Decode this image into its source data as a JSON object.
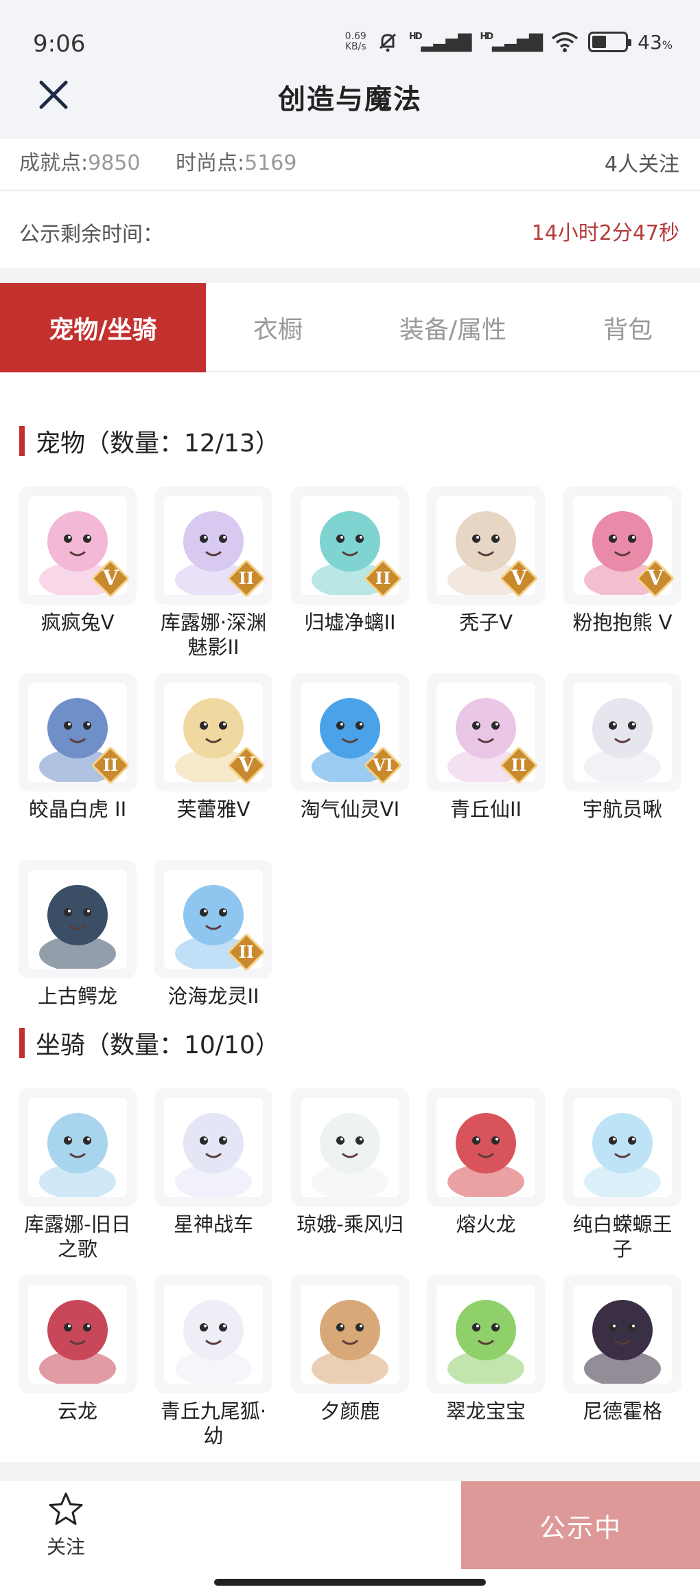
{
  "status_bar": {
    "time": "9:06",
    "net_speed": "0.69",
    "net_unit": "KB/s",
    "sim1": "HD",
    "sim2": "HD",
    "battery_percent": "43",
    "battery_fill": 0.43
  },
  "header": {
    "title": "创造与魔法",
    "close_icon": "close-icon"
  },
  "stats": {
    "achievement_label": "成就点:",
    "achievement_value": "9850",
    "fashion_label": "时尚点:",
    "fashion_value": "5169",
    "followers": "4人关注"
  },
  "timer": {
    "label": "公示剩余时间：",
    "value": "14小时2分47秒"
  },
  "tabs": [
    {
      "label": "宠物/坐骑",
      "active": true
    },
    {
      "label": "衣橱",
      "active": false
    },
    {
      "label": "装备/属性",
      "active": false
    },
    {
      "label": "背包",
      "active": false
    }
  ],
  "pets": {
    "title": "宠物（数量：12/13）",
    "items": [
      {
        "name": "疯疯兔V",
        "badge": "V",
        "color": "#f3b8d6"
      },
      {
        "name": "库露娜·深渊魅影II",
        "badge": "II",
        "color": "#d7c9f0"
      },
      {
        "name": "归墟净螭II",
        "badge": "II",
        "color": "#7fd3d0"
      },
      {
        "name": "秃子V",
        "badge": "V",
        "color": "#e8d6c4"
      },
      {
        "name": "粉抱抱熊 V",
        "badge": "V",
        "color": "#e88aa8"
      },
      {
        "name": "皎晶白虎 II",
        "badge": "II",
        "color": "#6f8fc8"
      },
      {
        "name": "芙蕾雅V",
        "badge": "V",
        "color": "#f0d9a0"
      },
      {
        "name": "淘气仙灵VI",
        "badge": "VI",
        "color": "#4aa3e8"
      },
      {
        "name": "青丘仙II",
        "badge": "II",
        "color": "#e9c6e6"
      },
      {
        "name": "宇航员啾",
        "badge": "",
        "color": "#e6e6ee"
      },
      {
        "name": "上古鳄龙",
        "badge": "",
        "color": "#3a4e66"
      },
      {
        "name": "沧海龙灵II",
        "badge": "II",
        "color": "#8ec6f0"
      }
    ]
  },
  "mounts": {
    "title": "坐骑（数量：10/10）",
    "items": [
      {
        "name": "库露娜-旧日之歌",
        "color": "#a9d4ee"
      },
      {
        "name": "星神战车",
        "color": "#e4e6f6"
      },
      {
        "name": "琼娥-乘风归",
        "color": "#eef3f2"
      },
      {
        "name": "熔火龙",
        "color": "#d9545a"
      },
      {
        "name": "纯白蝾螈王子",
        "color": "#bfe3f6"
      },
      {
        "name": "云龙",
        "color": "#c8485a"
      },
      {
        "name": "青丘九尾狐·幼",
        "color": "#eeeef6"
      },
      {
        "name": "夕颜鹿",
        "color": "#d8a878"
      },
      {
        "name": "翠龙宝宝",
        "color": "#8fd06a"
      },
      {
        "name": "尼德霍格",
        "color": "#3a2f44"
      }
    ]
  },
  "bottom": {
    "follow_label": "关注",
    "public_label": "公示中"
  }
}
